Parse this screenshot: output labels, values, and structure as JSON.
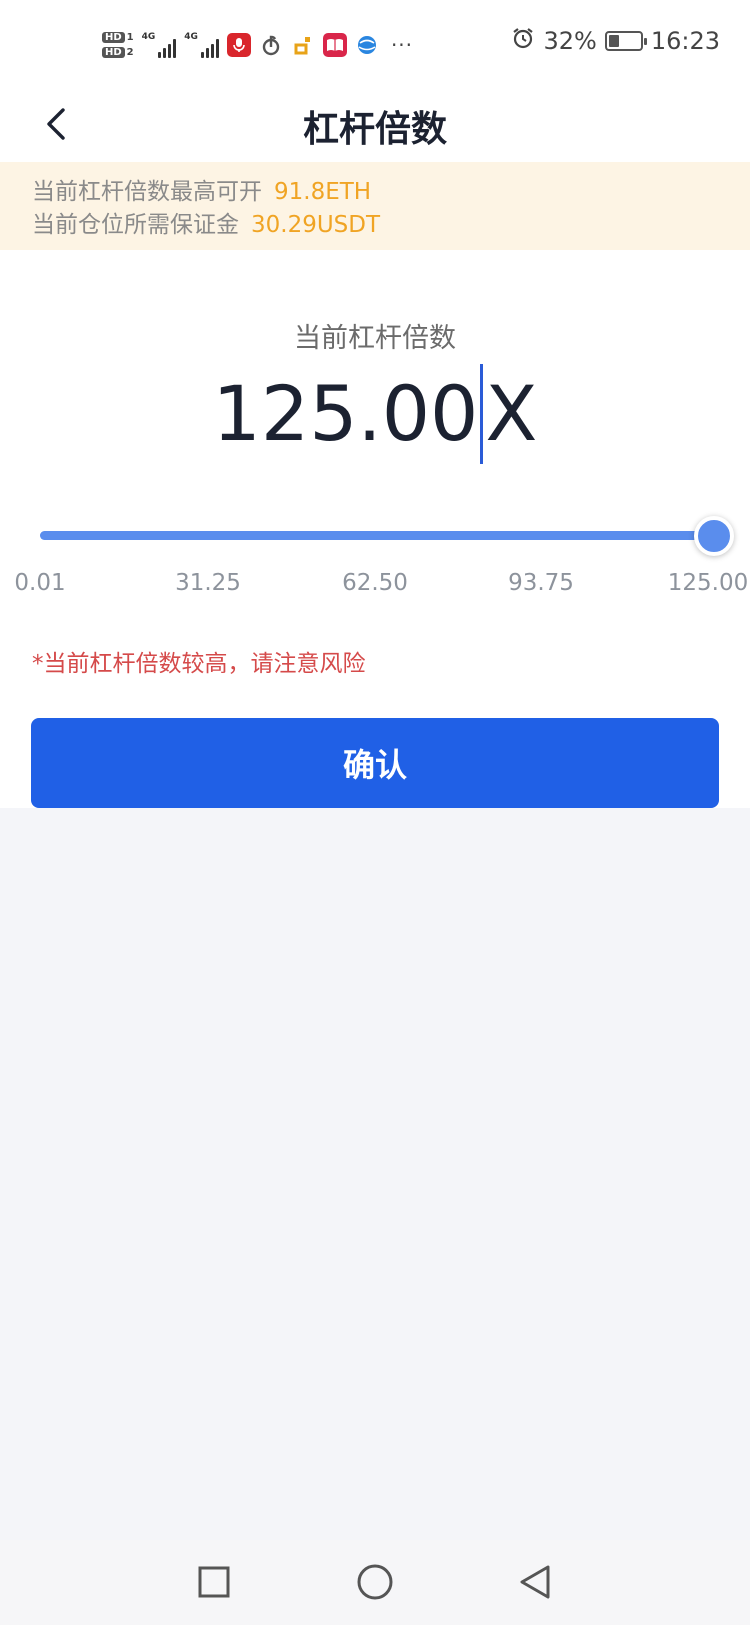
{
  "status_bar": {
    "sim1_label": "HD",
    "sim2_label": "HD",
    "net1_label": "4G",
    "net2_label": "4G",
    "overflow": "···",
    "battery_percent": "32%",
    "battery_level": 0.32,
    "time": "16:23"
  },
  "header": {
    "title": "杠杆倍数",
    "back_icon": "chevron-left-icon"
  },
  "notice": {
    "max_open_label": "当前杠杆倍数最高可开",
    "max_open_value": "91.8ETH",
    "margin_label": "当前仓位所需保证金",
    "margin_value": "30.29USDT",
    "value_color": "#f0a424"
  },
  "leverage": {
    "label": "当前杠杆倍数",
    "value": "125.00",
    "suffix": "X",
    "slider": {
      "min": 0.01,
      "max": 125.0,
      "current": 125.0,
      "ticks": [
        "0.01",
        "31.25",
        "62.50",
        "93.75",
        "125.00"
      ]
    },
    "warning": "*当前杠杆倍数较高，请注意风险"
  },
  "confirm_label": "确认",
  "colors": {
    "primary": "#2060e6",
    "slider": "#5a8ded",
    "warning": "#d54a4a",
    "notice_bg": "#fdf4e4"
  },
  "nav_bar": {
    "recent_icon": "square-icon",
    "home_icon": "circle-icon",
    "back_icon": "triangle-back-icon"
  }
}
